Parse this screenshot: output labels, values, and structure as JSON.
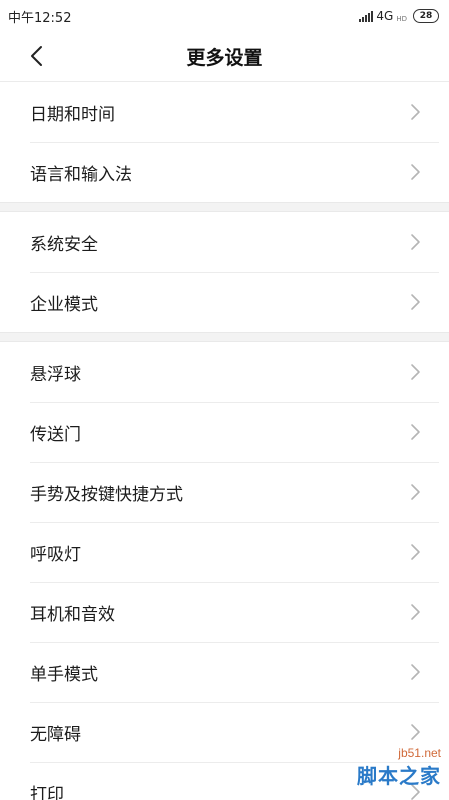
{
  "status_bar": {
    "time": "中午12:52",
    "network": "4G",
    "network_sub": "HD",
    "battery": "28"
  },
  "header": {
    "title": "更多设置",
    "back_icon": "chevron-left-icon"
  },
  "groups": [
    {
      "items": [
        {
          "label": "日期和时间"
        },
        {
          "label": "语言和输入法"
        }
      ]
    },
    {
      "items": [
        {
          "label": "系统安全"
        },
        {
          "label": "企业模式"
        }
      ]
    },
    {
      "items": [
        {
          "label": "悬浮球"
        },
        {
          "label": "传送门"
        },
        {
          "label": "手势及按键快捷方式"
        },
        {
          "label": "呼吸灯"
        },
        {
          "label": "耳机和音效"
        },
        {
          "label": "单手模式"
        },
        {
          "label": "无障碍"
        },
        {
          "label": "打印"
        }
      ]
    }
  ],
  "watermark": {
    "url": "jb51.net",
    "name": "脚本之家"
  },
  "colors": {
    "divider": "#ececec",
    "group_bg": "#f3f3f3",
    "chevron": "#b5b5b5"
  }
}
